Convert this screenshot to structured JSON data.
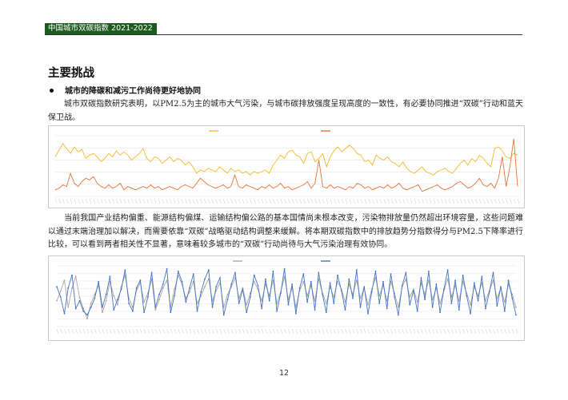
{
  "header": {
    "title": "中国城市双碳指数 2021-2022"
  },
  "section": {
    "title": "主要挑战",
    "bullet": "城市的降碳和减污工作尚待更好地协同",
    "paragraph1": "城市双碳指数研究表明，以PM2.5为主的城市大气污染，与城市碳排放强度呈现高度的一致性，有必要协同推进“双碳”行动和蓝天保卫战。",
    "paragraph2": "当前我国产业结构偏重、能源结构偏煤、运输结构偏公路的基本国情尚未根本改变，污染物排放量仍然超出环境容量，这些问题难以通过末端治理加以解决，而需要依靠“双碳”战略驱动结构调整来缓解。将本期双碳指数中的排放趋势分指数得分与PM2.5下降率进行比较，可以看到两者相关性不显著，意味着较多城市的“双碳”行动尚待与大气污染治理有效协同。"
  },
  "page": {
    "number": "12"
  },
  "chart_data": [
    {
      "type": "line",
      "series": [
        {
          "color": "#f5b82e",
          "values": [
            48,
            56,
            64,
            58,
            52,
            60,
            54,
            57,
            46,
            50,
            52,
            48,
            42,
            46,
            52,
            48,
            55,
            50,
            54,
            50,
            44,
            48,
            52,
            58,
            46,
            42,
            48,
            46,
            40,
            44,
            48,
            42,
            46,
            44,
            38,
            42,
            36,
            28,
            32,
            30,
            34,
            32,
            30,
            36,
            32,
            28,
            34,
            30,
            32,
            28,
            30,
            26,
            30,
            28,
            30,
            32,
            28,
            38,
            44,
            50,
            46,
            54,
            56,
            50,
            48,
            40,
            52,
            54,
            42,
            46,
            52,
            36,
            48,
            56,
            60,
            54,
            58,
            62,
            58,
            52,
            50,
            42,
            44,
            38,
            50,
            46,
            44,
            48,
            42,
            40,
            36,
            42,
            34,
            30,
            28,
            32,
            36,
            30,
            28,
            26,
            30,
            32,
            34,
            30,
            28,
            34,
            40,
            44,
            38,
            46,
            42,
            50,
            46,
            40,
            36,
            58,
            60,
            55,
            48,
            46,
            52,
            50
          ]
        },
        {
          "color": "#e3743c",
          "values": [
            8,
            10,
            14,
            12,
            28,
            16,
            12,
            18,
            22,
            20,
            24,
            16,
            12,
            10,
            14,
            10,
            12,
            16,
            8,
            12,
            10,
            8,
            10,
            12,
            10,
            14,
            10,
            12,
            8,
            10,
            12,
            10,
            8,
            12,
            14,
            12,
            10,
            16,
            22,
            18,
            14,
            12,
            10,
            12,
            14,
            10,
            12,
            26,
            12,
            10,
            14,
            12,
            10,
            8,
            12,
            10,
            14,
            10,
            12,
            16,
            10,
            12,
            8,
            10,
            12,
            14,
            18,
            10,
            16,
            44,
            12,
            10,
            14,
            10,
            12,
            10,
            8,
            12,
            10,
            16,
            14,
            10,
            12,
            8,
            10,
            12,
            10,
            14,
            10,
            12,
            16,
            10,
            8,
            10,
            12,
            14,
            6,
            8,
            10,
            12,
            14,
            10,
            8,
            10,
            12,
            16,
            18,
            14,
            10,
            12,
            16,
            22,
            14,
            12,
            16,
            10,
            22,
            48,
            12,
            36,
            70,
            12
          ]
        }
      ]
    },
    {
      "type": "line",
      "series": [
        {
          "color": "#a6a6a6",
          "values": [
            40,
            55,
            72,
            30,
            60,
            78,
            45,
            28,
            12,
            36,
            50,
            64,
            22,
            40,
            70,
            48,
            34,
            62,
            80,
            44,
            30,
            56,
            68,
            38,
            52,
            74,
            26,
            42,
            60,
            72,
            30,
            58,
            80,
            66,
            44,
            54,
            70,
            36,
            48,
            62,
            74,
            40,
            56,
            68,
            30,
            50,
            62,
            76,
            44,
            60,
            34,
            52,
            70,
            58,
            40,
            66,
            48,
            72,
            36,
            54,
            78,
            42,
            60,
            30,
            56,
            70,
            48,
            64,
            40,
            74,
            52,
            36,
            62,
            46,
            70,
            58,
            38,
            66,
            50,
            72,
            44,
            60,
            34,
            58,
            76,
            48,
            64,
            40,
            70,
            52,
            30,
            62,
            74,
            46,
            58,
            38,
            68,
            50,
            72,
            42,
            60,
            36,
            56,
            74,
            46,
            64,
            40,
            70,
            52,
            34,
            62,
            48,
            68,
            40,
            56,
            72,
            44,
            60,
            38,
            66,
            50,
            30
          ]
        },
        {
          "color": "#4472c4",
          "values": [
            62,
            46,
            20,
            60,
            80,
            28,
            40,
            24,
            18,
            30,
            44,
            70,
            30,
            50,
            78,
            26,
            42,
            58,
            88,
            36,
            24,
            60,
            72,
            22,
            46,
            84,
            30,
            50,
            66,
            90,
            22,
            48,
            86,
            70,
            38,
            60,
            82,
            24,
            54,
            74,
            88,
            30,
            62,
            76,
            18,
            42,
            66,
            84,
            36,
            58,
            22,
            46,
            80,
            64,
            28,
            74,
            40,
            86,
            24,
            52,
            90,
            34,
            66,
            20,
            60,
            82,
            38,
            70,
            26,
            84,
            50,
            22,
            68,
            36,
            80,
            56,
            26,
            74,
            44,
            88,
            30,
            62,
            20,
            54,
            86,
            36,
            70,
            28,
            82,
            46,
            18,
            64,
            84,
            34,
            56,
            24,
            76,
            42,
            86,
            30,
            66,
            22,
            58,
            88,
            36,
            72,
            26,
            80,
            48,
            20,
            68,
            40,
            78,
            28,
            54,
            84,
            32,
            62,
            24,
            72,
            44,
            18
          ]
        }
      ]
    }
  ]
}
